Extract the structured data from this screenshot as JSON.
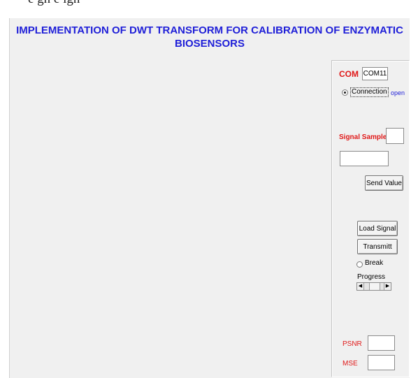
{
  "top_strip": {
    "partial_text": "e                gn                  e                  ign"
  },
  "figure": {
    "title_line1": "IMPLEMENTATION OF DWT TRANSFORM FOR CALIBRATION OF ENZYMATIC",
    "title_line2": "BIOSENSORS"
  },
  "panel": {
    "com_label": "COM",
    "com_value": "COM11",
    "connection_label": "Connection",
    "connection_status": "open",
    "signal_sample_label": "Signal Sample",
    "signal_sample_value": "",
    "send_field_value": "",
    "send_button": "Send Value",
    "load_button": "Load Signal",
    "transmit_button": "Transmitt",
    "break_label": "Break",
    "progress_label": "Progress",
    "progress_left_arrow": "◀",
    "progress_right_arrow": "▶",
    "psnr_label": "PSNR",
    "psnr_value": "",
    "mse_label": "MSE",
    "mse_value": ""
  },
  "colors": {
    "title": "#1f1fd8",
    "label_red": "#e01818",
    "background": "#f0f0f0"
  }
}
